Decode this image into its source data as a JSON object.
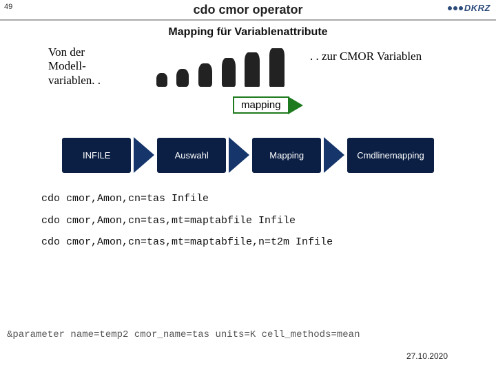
{
  "slide_number": "49",
  "title": "cdo cmor operator",
  "logo_text": "DKRZ",
  "subtitle": "Mapping für Variablenattribute",
  "left_text_l1": "Von der",
  "left_text_l2": "Modell-",
  "left_text_l3": "variablen. .",
  "right_text": ". . zur CMOR Variablen",
  "mapping_label": "mapping",
  "flow": {
    "b1": "INFILE",
    "b2": "Auswahl",
    "b3": "Mapping",
    "b4": "Cmdlinemapping"
  },
  "cmds": {
    "c1": "cdo cmor,Amon,cn=tas Infile",
    "c2": "cdo cmor,Amon,cn=tas,mt=maptabfile Infile",
    "c3": "cdo cmor,Amon,cn=tas,mt=maptabfile,n=t2m Infile"
  },
  "param": "&parameter name=temp2 cmor_name=tas units=K cell_methods=mean",
  "date": "27.10.2020"
}
